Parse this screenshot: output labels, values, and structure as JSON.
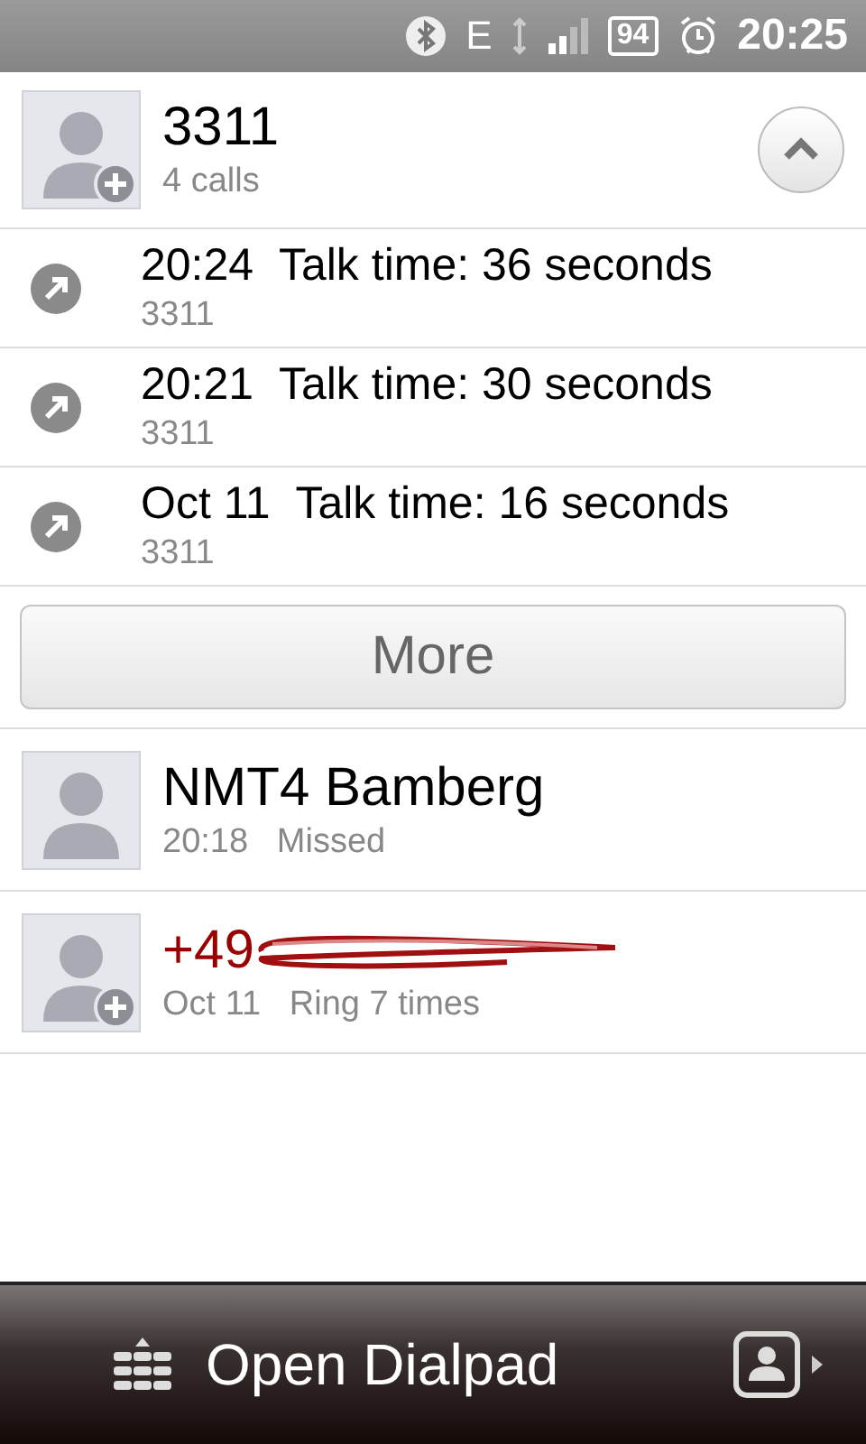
{
  "status_bar": {
    "network": "E",
    "battery": "94",
    "time": "20:25"
  },
  "group": {
    "name": "3311",
    "count": "4 calls",
    "expanded": true,
    "add_badge": true,
    "calls": [
      {
        "kind": "outgoing",
        "time": "20:24",
        "talk": "Talk time: 36 seconds",
        "number": "3311"
      },
      {
        "kind": "outgoing",
        "time": "20:21",
        "talk": "Talk time: 30 seconds",
        "number": "3311"
      },
      {
        "kind": "outgoing",
        "time": "Oct 11",
        "talk": "Talk time: 16 seconds",
        "number": "3311"
      }
    ],
    "more_button": "More"
  },
  "entries": [
    {
      "name": "NMT4 Bamberg",
      "time": "20:18",
      "detail": "Missed",
      "add_badge": false,
      "color": "#000000",
      "redacted": false
    },
    {
      "name": "+49",
      "time": "Oct 11",
      "detail": "Ring 7 times",
      "add_badge": true,
      "color": "#990000",
      "redacted": true
    }
  ],
  "bottom_bar": {
    "label": "Open Dialpad"
  }
}
